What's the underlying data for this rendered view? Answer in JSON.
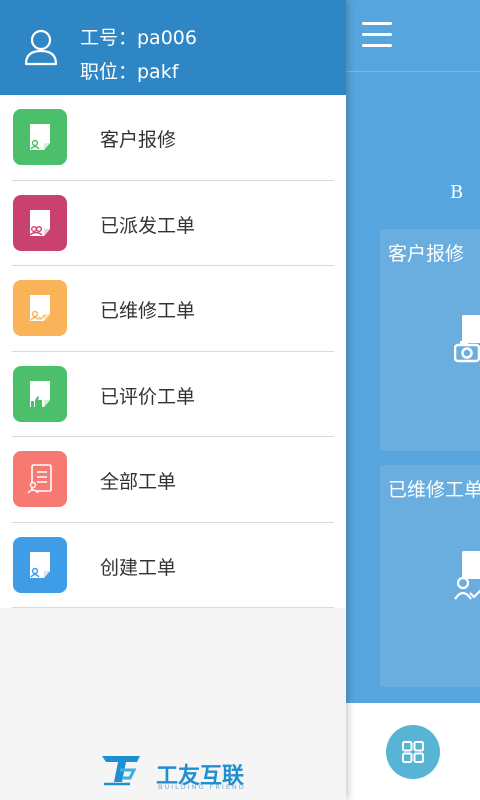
{
  "drawer": {
    "employee_id_label": "工号：pa006",
    "position_label": "职位：pakf",
    "menu": [
      {
        "label": "客户报修",
        "color": "#4cbf6b"
      },
      {
        "label": "已派发工单",
        "color": "#c9426f"
      },
      {
        "label": "已维修工单",
        "color": "#fbb35a"
      },
      {
        "label": "已评价工单",
        "color": "#4cbf6b"
      },
      {
        "label": "全部工单",
        "color": "#f67a72"
      },
      {
        "label": "创建工单",
        "color": "#3f9ce6"
      }
    ],
    "logo_text": "工友互联",
    "logo_sub": "BUILDING FRIEND"
  },
  "main": {
    "brand_partial": "B U",
    "tiles": [
      {
        "label": "客户报修"
      },
      {
        "label": "已维修工单"
      }
    ]
  },
  "colors": {
    "header": "#2f86c4",
    "main_bg": "#57a5de",
    "tile_bg": "#6aaee0",
    "grid_button": "#57b4d4"
  }
}
